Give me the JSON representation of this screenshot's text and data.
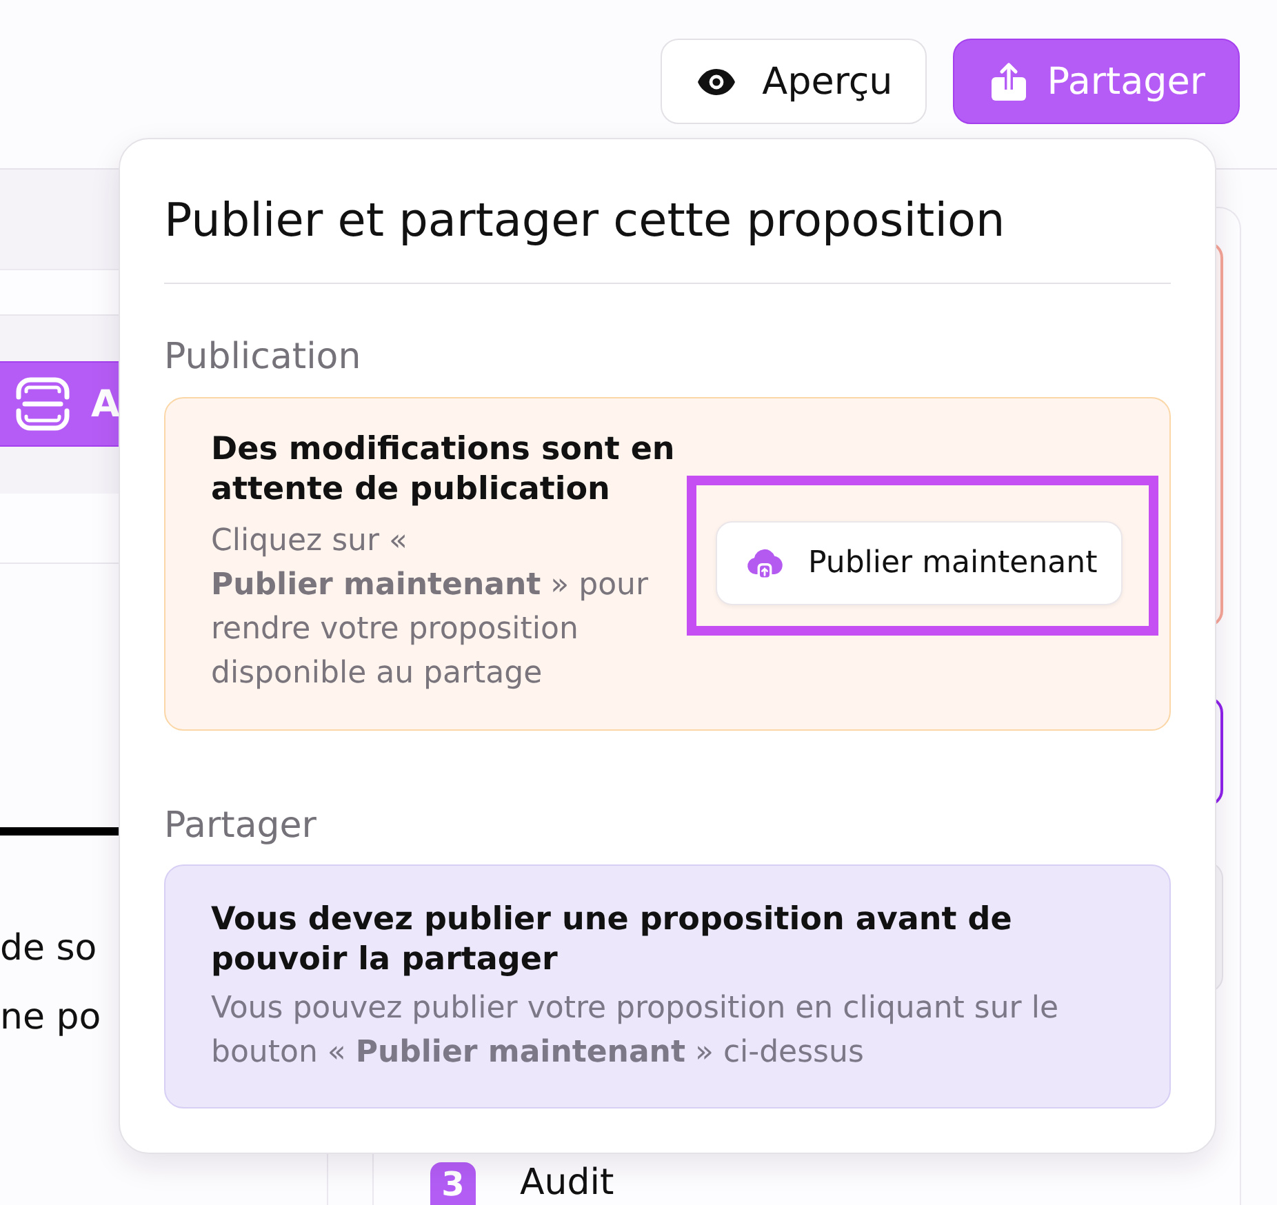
{
  "header": {
    "buttons": [
      {
        "kind": "outline",
        "label": "Aperçu"
      },
      {
        "kind": "filled",
        "label": "Partager"
      }
    ]
  },
  "sidebar": {
    "action_button": {
      "label": "A"
    },
    "text_lines": [
      "de so",
      "ne po"
    ]
  },
  "content": {
    "steps": [
      {
        "number": "3",
        "label": "Audit"
      }
    ]
  },
  "popover": {
    "title": "Publier et partager cette proposition",
    "sections": [
      {
        "label": "Publication",
        "kind": "warning",
        "heading": "Des modifications sont en attente de publication",
        "text": "Cliquez sur « **Publier maintenant** » pour rendre votre proposition disponible au partage",
        "button": {
          "label": "Publier maintenant",
          "highlighted": true
        }
      },
      {
        "label": "Partager",
        "kind": "info",
        "heading": "Vous devez publier une proposition avant de pouvoir la partager",
        "text": "Vous pouvez publier votre proposition en cliquant sur le bouton « **Publier maintenant** » ci-dessus"
      }
    ]
  }
}
